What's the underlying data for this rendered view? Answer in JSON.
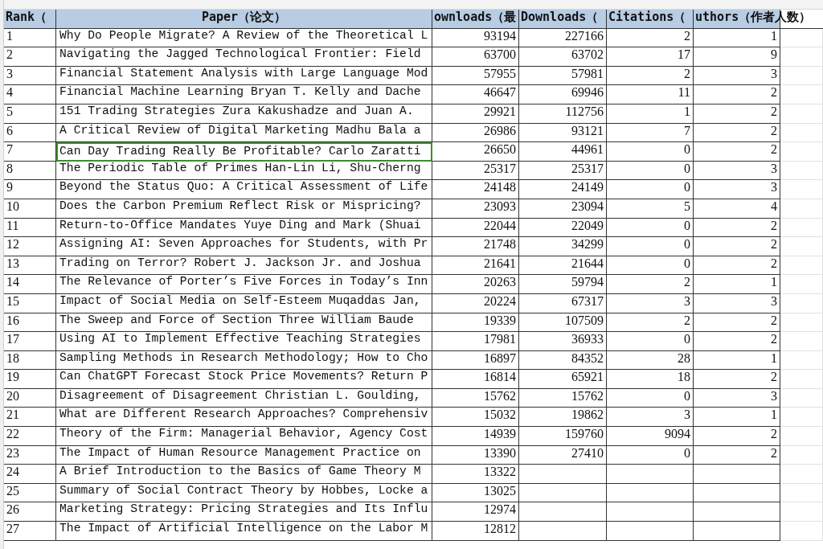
{
  "columns": [
    {
      "header": "Rank（"
    },
    {
      "header": "Paper（论文）"
    },
    {
      "header": "ownloads（最"
    },
    {
      "header": "Downloads（"
    },
    {
      "header": "Citations（"
    },
    {
      "header": "uthors（作者人数）"
    }
  ],
  "rows": [
    {
      "selected": false,
      "cells": [
        "1",
        "Why Do People Migrate? A Review of the Theoretical L",
        "93194",
        "227166",
        "2",
        "1"
      ]
    },
    {
      "selected": false,
      "cells": [
        "2",
        "Navigating the Jagged Technological Frontier: Field",
        "63700",
        "63702",
        "17",
        "9"
      ]
    },
    {
      "selected": false,
      "cells": [
        "3",
        "Financial Statement Analysis with Large Language Mod",
        "57955",
        "57981",
        "2",
        "3"
      ]
    },
    {
      "selected": false,
      "cells": [
        "4",
        "Financial Machine Learning  Bryan T. Kelly and Dache",
        "46647",
        "69946",
        "11",
        "2"
      ]
    },
    {
      "selected": false,
      "cells": [
        "5",
        "151 Trading Strategies  Zura Kakushadze and Juan A.",
        "29921",
        "112756",
        "1",
        "2"
      ]
    },
    {
      "selected": false,
      "cells": [
        "6",
        "A Critical Review of Digital Marketing  Madhu Bala a",
        "26986",
        "93121",
        "7",
        "2"
      ]
    },
    {
      "selected": true,
      "cells": [
        "7",
        "Can Day Trading Really Be Profitable?  Carlo Zaratti",
        "26650",
        "44961",
        "0",
        "2"
      ]
    },
    {
      "selected": false,
      "cells": [
        "8",
        "The Periodic Table of Primes  Han-Lin Li, Shu-Cherng",
        "25317",
        "25317",
        "0",
        "3"
      ]
    },
    {
      "selected": false,
      "cells": [
        "9",
        "Beyond the Status Quo: A Critical Assessment of Life",
        "24148",
        "24149",
        "0",
        "3"
      ]
    },
    {
      "selected": false,
      "cells": [
        "10",
        "Does the Carbon Premium Reflect Risk or Mispricing?",
        "23093",
        "23094",
        "5",
        "4"
      ]
    },
    {
      "selected": false,
      "cells": [
        "11",
        "Return-to-Office Mandates  Yuye Ding and Mark (Shuai",
        "22044",
        "22049",
        "0",
        "2"
      ]
    },
    {
      "selected": false,
      "cells": [
        "12",
        "Assigning AI: Seven Approaches for Students, with Pr",
        "21748",
        "34299",
        "0",
        "2"
      ]
    },
    {
      "selected": false,
      "cells": [
        "13",
        "Trading on Terror?  Robert J. Jackson Jr. and Joshua",
        "21641",
        "21644",
        "0",
        "2"
      ]
    },
    {
      "selected": false,
      "cells": [
        "14",
        "The Relevance of Porter’s Five Forces in Today’s Inn",
        "20263",
        "59794",
        "2",
        "1"
      ]
    },
    {
      "selected": false,
      "cells": [
        "15",
        "Impact of Social Media on Self-Esteem  Muqaddas Jan,",
        "20224",
        "67317",
        "3",
        "3"
      ]
    },
    {
      "selected": false,
      "cells": [
        "16",
        "The Sweep and Force of Section Three  William Baude",
        "19339",
        "107509",
        "2",
        "2"
      ]
    },
    {
      "selected": false,
      "cells": [
        "17",
        "Using AI to Implement Effective Teaching Strategies",
        "17981",
        "36933",
        "0",
        "2"
      ]
    },
    {
      "selected": false,
      "cells": [
        "18",
        "Sampling Methods in Research Methodology; How to Cho",
        "16897",
        "84352",
        "28",
        "1"
      ]
    },
    {
      "selected": false,
      "cells": [
        "19",
        "Can ChatGPT Forecast Stock Price Movements? Return P",
        "16814",
        "65921",
        "18",
        "2"
      ]
    },
    {
      "selected": false,
      "cells": [
        "20",
        "Disagreement of Disagreement  Christian L. Goulding,",
        "15762",
        "15762",
        "0",
        "3"
      ]
    },
    {
      "selected": false,
      "cells": [
        "21",
        "What are Different Research Approaches? Comprehensiv",
        "15032",
        "19862",
        "3",
        "1"
      ]
    },
    {
      "selected": false,
      "cells": [
        "22",
        "Theory of the Firm: Managerial Behavior, Agency Cost",
        "14939",
        "159760",
        "9094",
        "2"
      ]
    },
    {
      "selected": false,
      "cells": [
        "23",
        "The Impact of Human Resource Management Practice on",
        "13390",
        "27410",
        "0",
        "2"
      ]
    },
    {
      "selected": false,
      "cells": [
        "24",
        "A Brief Introduction to the Basics of Game Theory  M",
        "13322"
      ]
    },
    {
      "selected": false,
      "cells": [
        "25",
        "Summary of Social Contract Theory by Hobbes, Locke a",
        "13025"
      ]
    },
    {
      "selected": false,
      "cells": [
        "26",
        "Marketing Strategy: Pricing Strategies and Its Influ",
        "12974"
      ]
    },
    {
      "selected": false,
      "cells": [
        "27",
        "The Impact of Artificial Intelligence on the Labor M",
        "12812"
      ]
    }
  ]
}
